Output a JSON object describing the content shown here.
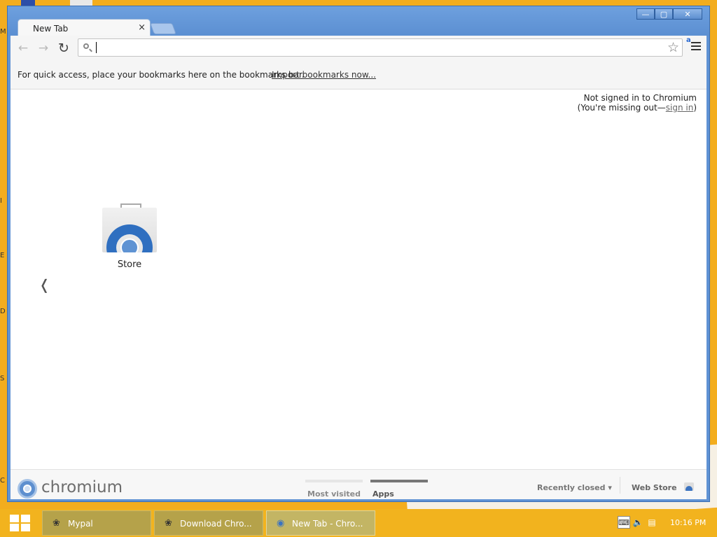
{
  "desktop": {
    "edge_letters": [
      "M",
      "I",
      "E",
      "D",
      "S",
      "C"
    ]
  },
  "window": {
    "controls": {
      "minimize": "—",
      "maximize": "▢",
      "close": "✕"
    }
  },
  "tab": {
    "title": "New Tab",
    "close": "×"
  },
  "toolbar": {
    "back_icon": "back-arrow-icon",
    "forward_icon": "forward-arrow-icon",
    "reload_icon": "reload-icon",
    "omnibox_value": "",
    "ext_badge": "a"
  },
  "bookmarks_bar": {
    "message": "For quick access, place your bookmarks here on the bookmarks bar.",
    "import_link": "Import bookmarks now..."
  },
  "signin": {
    "line1": "Not signed in to Chromium",
    "line2_prefix": "(You're missing out—",
    "link": "sign in",
    "line2_suffix": ")"
  },
  "apps": [
    {
      "label": "Store"
    }
  ],
  "pager": {
    "prev": "❬"
  },
  "footer": {
    "brand": "chromium",
    "tabs": [
      {
        "label": "Most visited",
        "active": false
      },
      {
        "label": "Apps",
        "active": true
      }
    ],
    "recently_closed": "Recently closed ▾",
    "web_store": "Web Store"
  },
  "taskbar": {
    "tasks": [
      {
        "label": "Mypal",
        "active": false
      },
      {
        "label": "Download Chro...",
        "active": false
      },
      {
        "label": "New Tab - Chro...",
        "active": true
      }
    ],
    "clock": "10:16 PM"
  },
  "colors": {
    "desktop": "#f3ad1e",
    "titlebar": "#5f92d4",
    "taskbar": "#f2b31e"
  }
}
